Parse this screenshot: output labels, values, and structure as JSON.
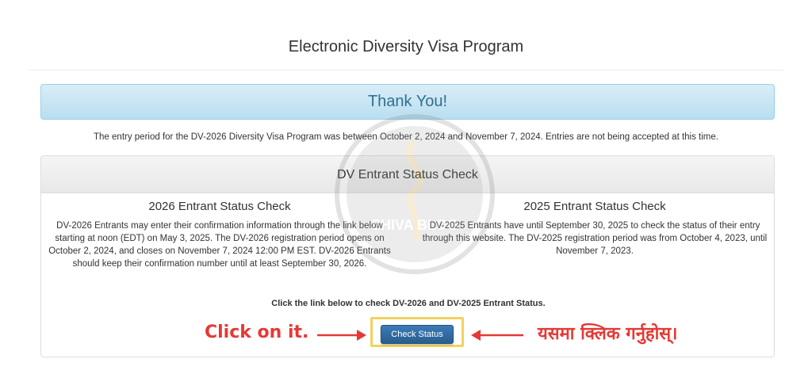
{
  "page": {
    "title": "Electronic Diversity Visa Program"
  },
  "alert": {
    "text": "Thank You!"
  },
  "entry_note": "The entry period for the DV-2026 Diversity Visa Program was between October 2, 2024 and November 7, 2024. Entries are not being accepted at this time.",
  "panel": {
    "heading": "DV Entrant Status Check",
    "left": {
      "title": "2026 Entrant Status Check",
      "body": "DV-2026 Entrants may enter their confirmation information through the link below starting at noon (EDT) on May 3, 2025. The DV-2026 registration period opens on October 2, 2024, and closes on November 7, 2024 12:00 PM EST. DV-2026 Entrants should keep their confirmation number until at least September 30, 2026."
    },
    "right": {
      "title": "2025 Entrant Status Check",
      "body": "DV-2025 Entrants have until September 30, 2025 to check the status of their entry through this website. The DV-2025 registration period was from October 4, 2023, until November 7, 2023."
    },
    "click_note": "Click the link below to check DV-2026 and DV-2025 Entrant Status.",
    "button_label": "Check Status"
  },
  "annotations": {
    "left_text": "Click on it.",
    "right_text": "यसमा क्लिक गर्नुहोस्।",
    "color": "#e53935"
  },
  "watermark": {
    "text": "SHIVA BLOG"
  }
}
